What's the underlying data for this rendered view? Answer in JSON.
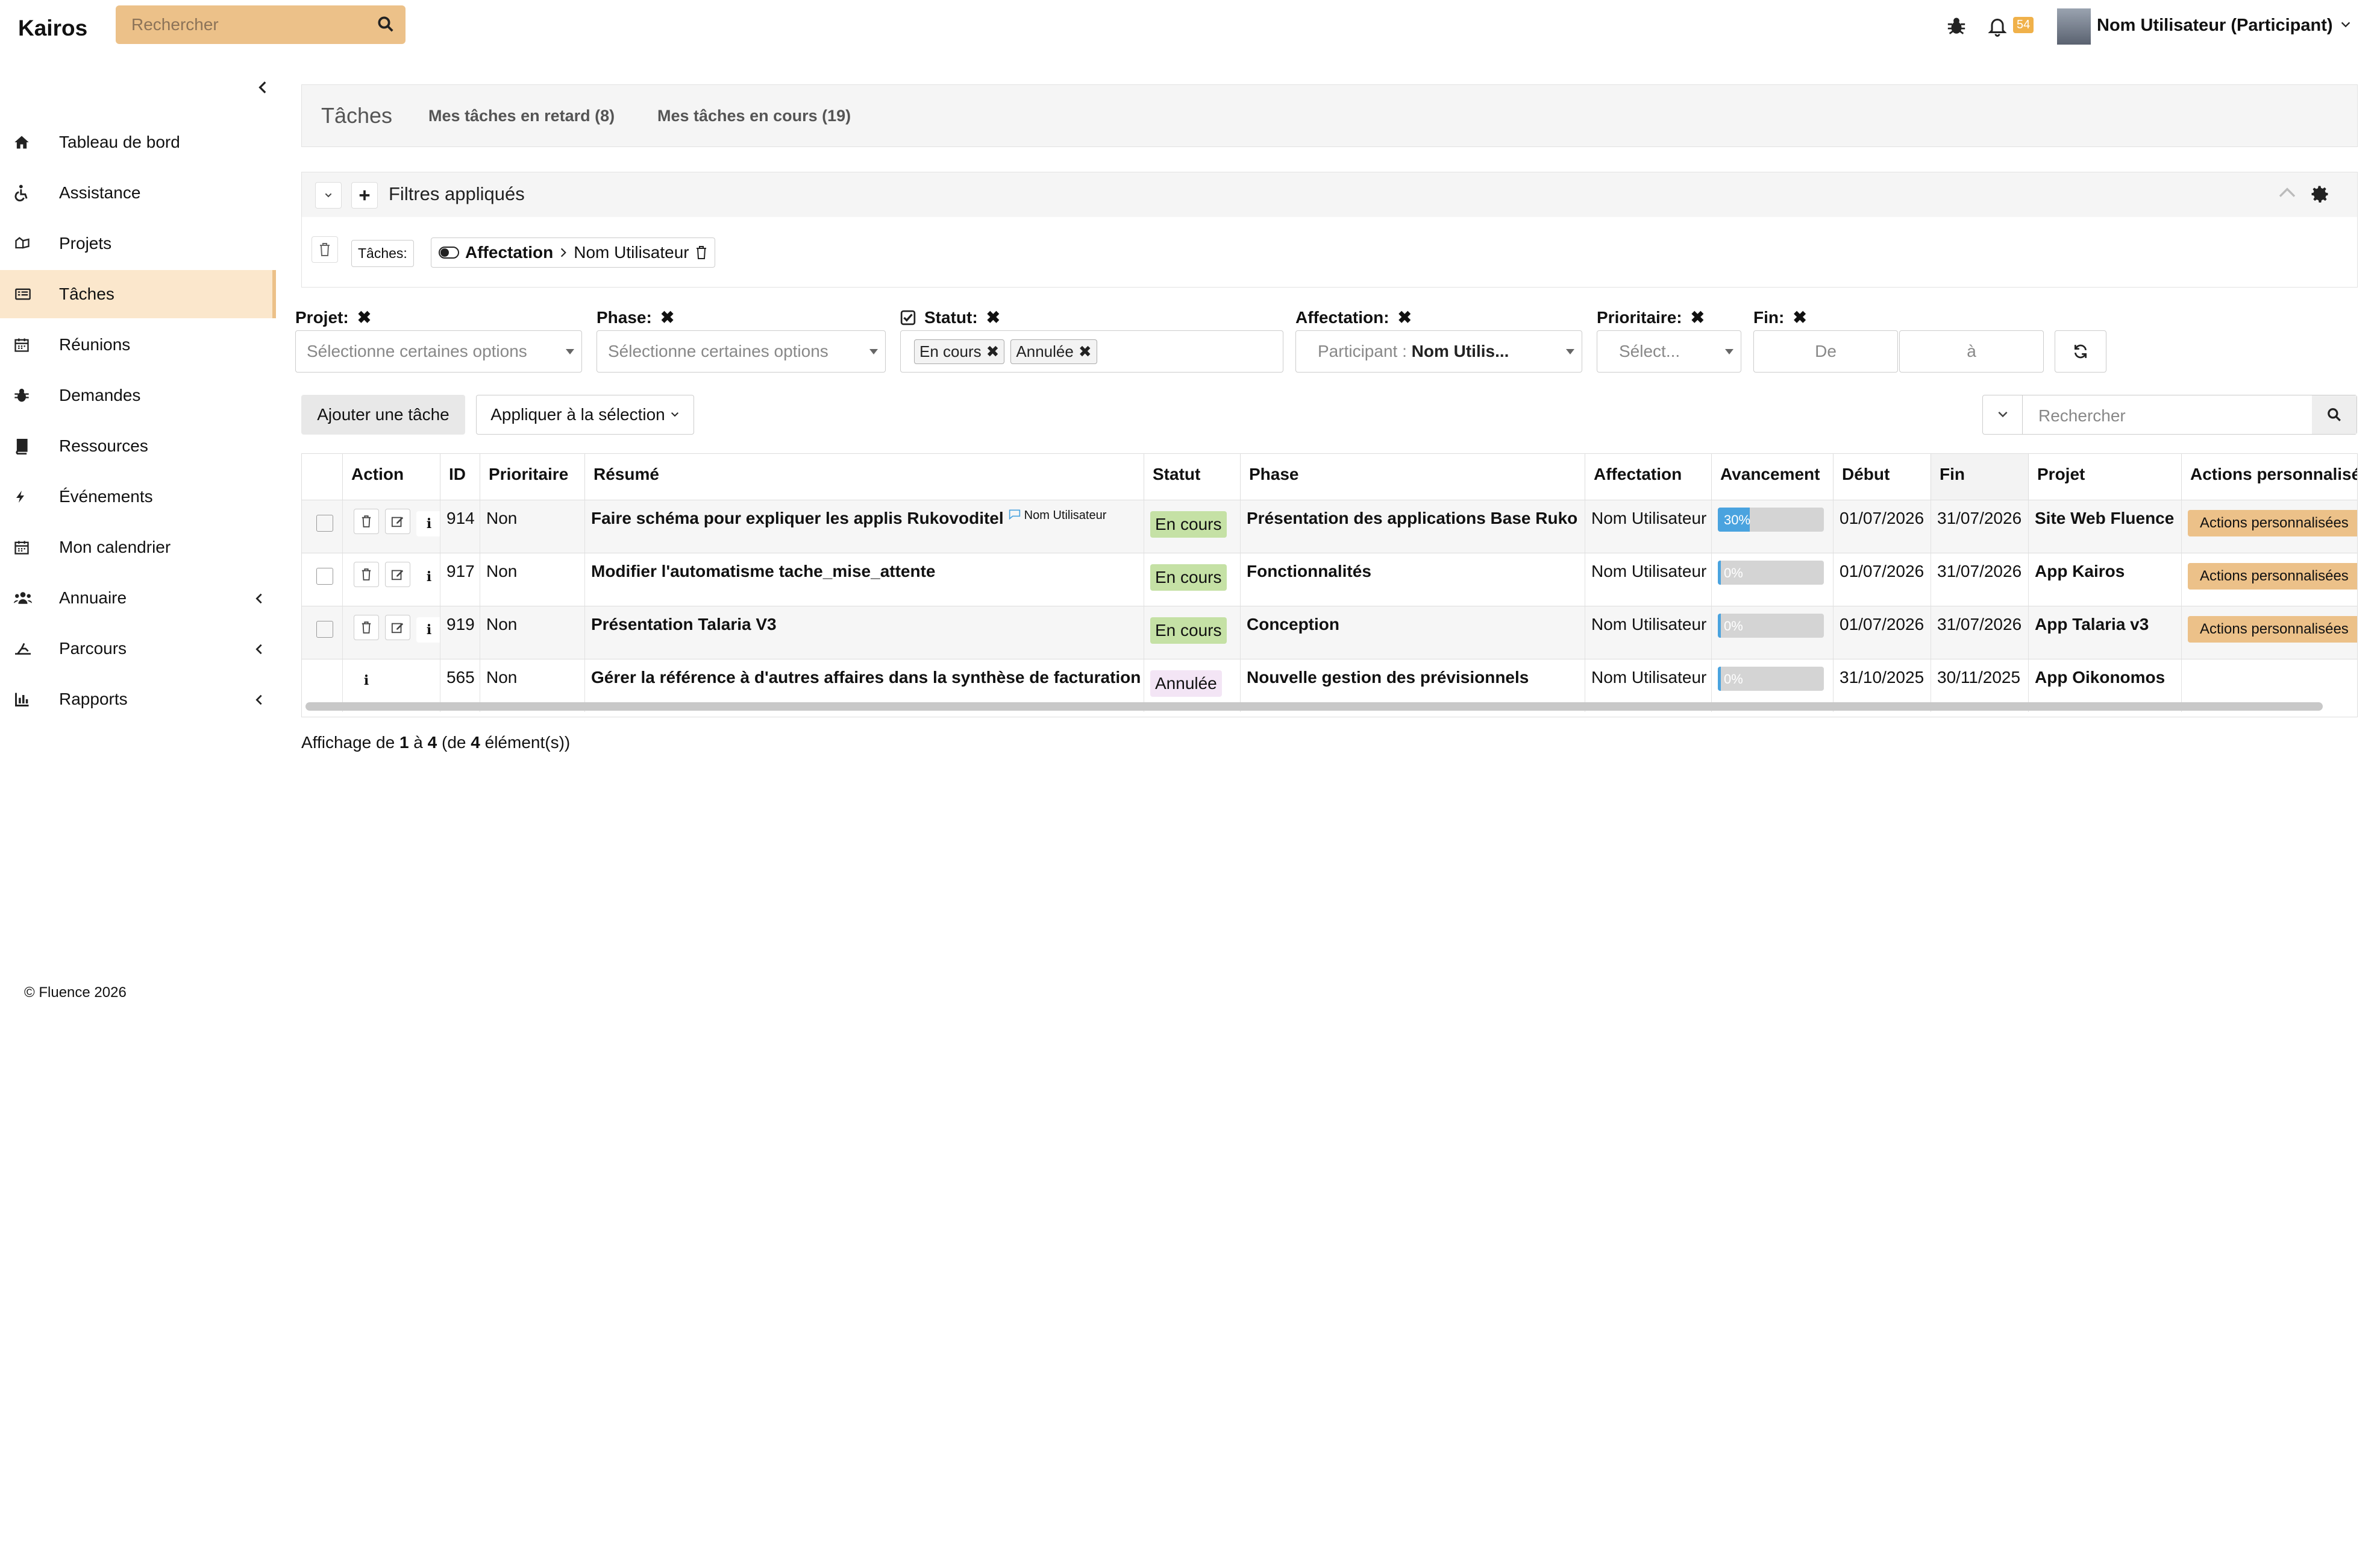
{
  "app": {
    "title": "Kairos"
  },
  "topbar": {
    "search_placeholder": "Rechercher",
    "notif_count": "54",
    "user_label": "Nom Utilisateur (Participant)"
  },
  "sidebar": {
    "items": [
      {
        "label": "Tableau de bord",
        "icon": "home-icon"
      },
      {
        "label": "Assistance",
        "icon": "wheelchair-icon"
      },
      {
        "label": "Projets",
        "icon": "project-icon"
      },
      {
        "label": "Tâches",
        "icon": "tasks-icon",
        "active": true
      },
      {
        "label": "Réunions",
        "icon": "calendar-icon"
      },
      {
        "label": "Demandes",
        "icon": "bug-icon"
      },
      {
        "label": "Ressources",
        "icon": "book-icon"
      },
      {
        "label": "Événements",
        "icon": "bolt-icon"
      },
      {
        "label": "Mon calendrier",
        "icon": "calendar-icon"
      },
      {
        "label": "Annuaire",
        "icon": "users-icon",
        "expandable": true
      },
      {
        "label": "Parcours",
        "icon": "route-icon",
        "expandable": true
      },
      {
        "label": "Rapports",
        "icon": "chart-icon",
        "expandable": true
      }
    ],
    "footer": "© Fluence 2026"
  },
  "tabs": {
    "title": "Tâches",
    "late": "Mes tâches en retard (8)",
    "ongoing": "Mes tâches en cours (19)"
  },
  "filters": {
    "title": "Filtres appliqués",
    "scope_label": "Tâches:",
    "chip_field": "Affectation",
    "chip_value": "Nom Utilisateur",
    "projet_label": "Projet:",
    "phase_label": "Phase:",
    "statut_label": "Statut:",
    "affectation_label": "Affectation:",
    "prioritaire_label": "Prioritaire:",
    "fin_label": "Fin:",
    "select_placeholder": "Sélectionne certaines options",
    "statut_tags": [
      "En cours",
      "Annulée"
    ],
    "participant_prefix": "Participant :",
    "participant_value": "Nom Utilis...",
    "prioritaire_placeholder": "Sélect...",
    "date_from": "De",
    "date_to": "à"
  },
  "actions": {
    "add_task": "Ajouter une tâche",
    "apply_selection": "Appliquer à la sélection",
    "search_placeholder": "Rechercher"
  },
  "table": {
    "headers": [
      "Action",
      "ID",
      "Prioritaire",
      "Résumé",
      "Statut",
      "Phase",
      "Affectation",
      "Avancement",
      "Début",
      "Fin",
      "Projet",
      "Actions personnalisé"
    ],
    "custom_action_label": "Actions personnalisées",
    "rows": [
      {
        "id": "914",
        "prio": "Non",
        "resume": "Faire schéma pour expliquer les applis Rukovoditel",
        "comment_user": "Nom Utilisateur",
        "statut": "En cours",
        "phase": "Présentation des applications Base Ruko",
        "affectation": "Nom Utilisateur",
        "progress": 30,
        "progress_label": "30%",
        "debut": "01/07/2026",
        "fin": "31/07/2026",
        "projet": "Site Web Fluence",
        "editable": true
      },
      {
        "id": "917",
        "prio": "Non",
        "resume": "Modifier l'automatisme tache_mise_attente",
        "comment_user": "",
        "statut": "En cours",
        "phase": "Fonctionnalités",
        "affectation": "Nom Utilisateur",
        "progress": 0,
        "progress_label": "0%",
        "debut": "01/07/2026",
        "fin": "31/07/2026",
        "projet": "App Kairos",
        "editable": true
      },
      {
        "id": "919",
        "prio": "Non",
        "resume": "Présentation Talaria V3",
        "comment_user": "",
        "statut": "En cours",
        "phase": "Conception",
        "affectation": "Nom Utilisateur",
        "progress": 0,
        "progress_label": "0%",
        "debut": "01/07/2026",
        "fin": "31/07/2026",
        "projet": "App Talaria v3",
        "editable": true
      },
      {
        "id": "565",
        "prio": "Non",
        "resume": "Gérer la référence à d'autres affaires dans la synthèse de facturation",
        "comment_user": "",
        "statut": "Annulée",
        "phase": "Nouvelle gestion des prévisionnels",
        "affectation": "Nom Utilisateur",
        "progress": 0,
        "progress_label": "0%",
        "debut": "31/10/2025",
        "fin": "30/11/2025",
        "projet": "App Oikonomos",
        "editable": false
      }
    ]
  },
  "pagination": {
    "prefix": "Affichage de ",
    "from": "1",
    "mid": " à ",
    "to": "4",
    "of_prefix": " (de ",
    "total": "4",
    "suffix": " élément(s))"
  },
  "colors": {
    "accent": "#ecc189",
    "active_bg": "#fbe7cc",
    "en_cours": "#c5e1a5",
    "annulee": "#f3e5f5",
    "progress": "#4aa3df"
  }
}
